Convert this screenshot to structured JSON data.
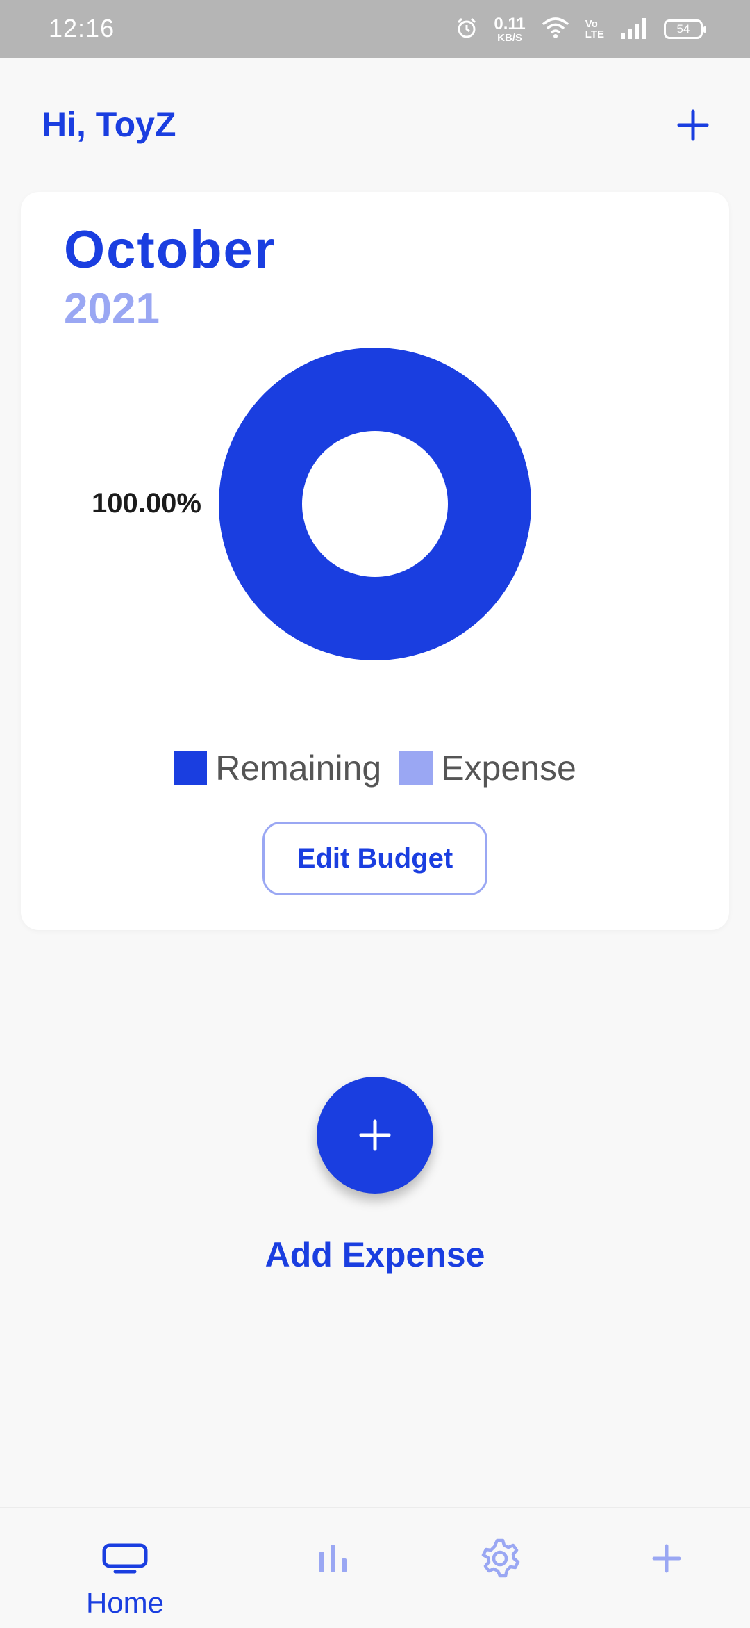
{
  "status_bar": {
    "time": "12:16",
    "net_speed_value": "0.11",
    "net_speed_unit": "KB/S",
    "volte_top": "Vo",
    "volte_bottom": "LTE",
    "battery": "54"
  },
  "header": {
    "greeting": "Hi, ToyZ",
    "add_icon": "plus-icon"
  },
  "budget_card": {
    "month": "October",
    "year": "2021",
    "edit_button_label": "Edit Budget"
  },
  "chart_data": {
    "type": "pie",
    "style": "donut",
    "slices": [
      {
        "label": "Remaining",
        "value": 100.0,
        "color": "#1a3ee0"
      },
      {
        "label": "Expense",
        "value": 0.0,
        "color": "#9aa7f3"
      }
    ],
    "data_labels": [
      "100.00%"
    ],
    "legend": [
      "Remaining",
      "Expense"
    ],
    "legend_position": "bottom"
  },
  "main": {
    "fab_icon": "plus-icon",
    "fab_label": "Add Expense"
  },
  "bottom_nav": {
    "items": [
      {
        "label": "Home",
        "icon": "tv-icon",
        "active": true
      },
      {
        "label": "",
        "icon": "bar-chart-icon",
        "active": false
      },
      {
        "label": "",
        "icon": "gear-icon",
        "active": false
      },
      {
        "label": "",
        "icon": "plus-icon",
        "active": false
      }
    ]
  },
  "colors": {
    "primary": "#1a3ee0",
    "secondary": "#9aa7f3",
    "status_bar": "#b5b5b5",
    "background": "#f8f8f8"
  }
}
